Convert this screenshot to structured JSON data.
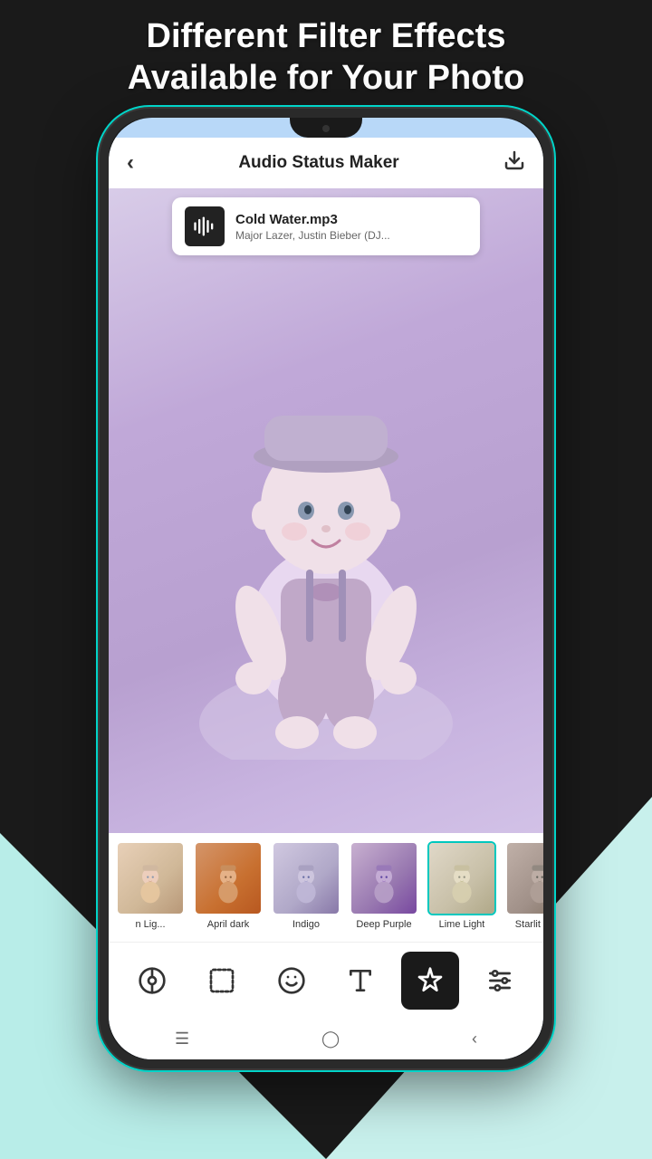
{
  "page": {
    "title_line1": "Different Filter Effects",
    "title_line2": "Available for Your Photo"
  },
  "header": {
    "back_icon": "chevron-left",
    "title": "Audio Status Maker",
    "download_icon": "download"
  },
  "audio": {
    "title": "Cold Water.mp3",
    "subtitle": "Major Lazer, Justin Bieber (DJ..."
  },
  "filters": [
    {
      "id": "prev",
      "label": "n Lig...",
      "active": false
    },
    {
      "id": "april-dark",
      "label": "April dark",
      "active": false
    },
    {
      "id": "indigo",
      "label": "Indigo",
      "active": false
    },
    {
      "id": "deep-purple",
      "label": "Deep Purple",
      "active": false
    },
    {
      "id": "lime-light",
      "label": "Lime Light",
      "active": false
    },
    {
      "id": "starlit-dark",
      "label": "Starlit Dark",
      "active": false
    }
  ],
  "toolbar": {
    "buttons": [
      {
        "id": "music",
        "label": "music",
        "active": false
      },
      {
        "id": "frame",
        "label": "frame",
        "active": false
      },
      {
        "id": "sticker",
        "label": "sticker",
        "active": false
      },
      {
        "id": "text",
        "label": "text",
        "active": false
      },
      {
        "id": "filter",
        "label": "filter",
        "active": true
      },
      {
        "id": "adjust",
        "label": "adjust",
        "active": false
      }
    ]
  },
  "nav": {
    "items": [
      "menu",
      "home",
      "back"
    ]
  }
}
